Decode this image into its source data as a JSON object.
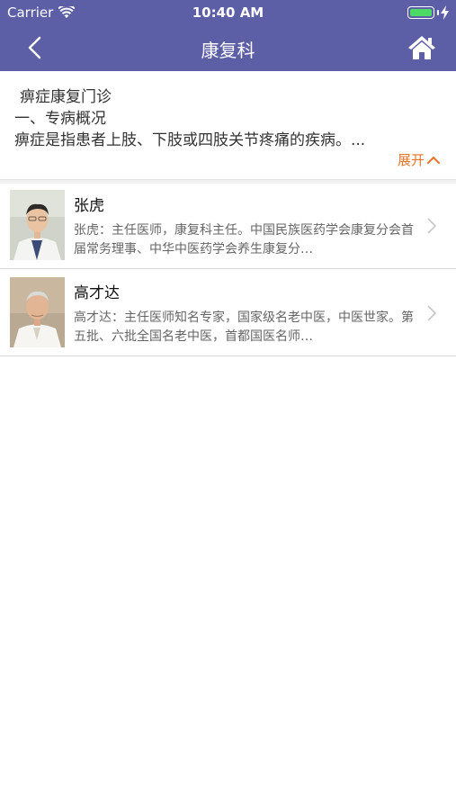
{
  "status_bar": {
    "carrier": "Carrier",
    "time": "10:40 AM"
  },
  "nav": {
    "title": "康复科",
    "back_icon": "chevron-left-icon",
    "home_icon": "home-icon"
  },
  "intro": {
    "title": "痹症康复门诊",
    "line1": "一、专病概况",
    "line2": "痹症是指患者上肢、下肢或四肢关节疼痛的疾病。...",
    "expand_label": "展开"
  },
  "doctors": [
    {
      "name": "张虎",
      "bio": "张虎：主任医师，康复科主任。中国民族医药学会康复分会首届常务理事、中华中医药学会养生康复分…"
    },
    {
      "name": "高才达",
      "bio": "高才达：主任医师知名专家，国家级名老中医，中医世家。第五批、六批全国名老中医，首都国医名师…"
    }
  ],
  "colors": {
    "nav_background": "#5c5ea6",
    "expand_accent": "#e8752a",
    "battery_green": "#4cd964"
  }
}
